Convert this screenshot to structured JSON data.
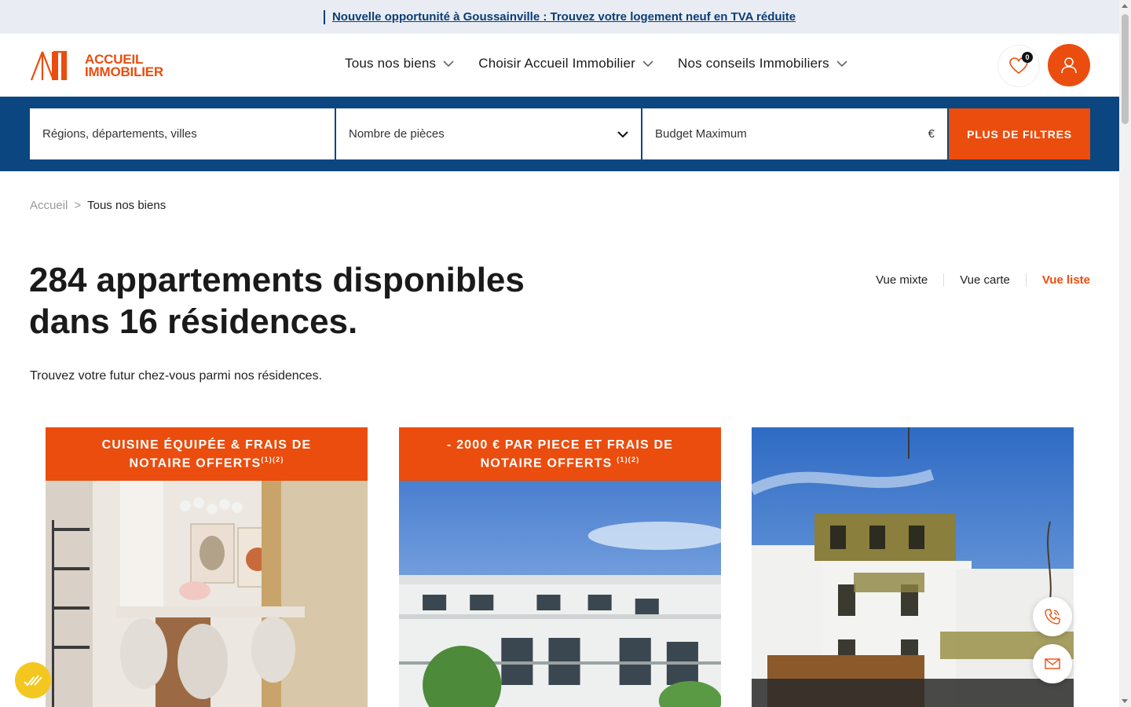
{
  "banner": {
    "text": "Nouvelle opportunité à Goussainville : Trouvez votre logement neuf en TVA réduite"
  },
  "header": {
    "logo_line1": "ACCUEIL",
    "logo_line2": "IMMOBILIER",
    "nav": [
      {
        "label": "Tous nos biens"
      },
      {
        "label": "Choisir Accueil Immobilier"
      },
      {
        "label": "Nos conseils Immobiliers"
      }
    ],
    "favorites_count": "0",
    "accent_color": "#ea4d0e",
    "brand_blue": "#0b4680"
  },
  "search": {
    "location_placeholder": "Régions, départements, villes",
    "rooms_placeholder": "Nombre de pièces",
    "budget_placeholder": "Budget Maximum",
    "currency": "€",
    "filters_button": "PLUS DE FILTRES"
  },
  "breadcrumb": {
    "home": "Accueil",
    "separator": ">",
    "current": "Tous nos biens"
  },
  "main": {
    "title_line1": "284 appartements disponibles",
    "title_line2": "dans 16 résidences.",
    "subtitle": "Trouvez votre futur chez-vous parmi nos résidences.",
    "views": [
      {
        "label": "Vue mixte",
        "active": false
      },
      {
        "label": "Vue carte",
        "active": false
      },
      {
        "label": "Vue liste",
        "active": true
      }
    ]
  },
  "cards": [
    {
      "badge": "CUISINE ÉQUIPÉE & FRAIS DE NOTAIRE OFFERTS",
      "badge_sup": "(1)(2)"
    },
    {
      "badge": "- 2000 € PAR PIECE ET FRAIS DE NOTAIRE OFFERTS",
      "badge_sup": "(1)(2)"
    },
    {
      "badge": "",
      "badge_sup": ""
    }
  ],
  "icons": {
    "favorites": "heart-icon",
    "account": "user-icon",
    "phone": "phone-icon",
    "mail": "mail-icon",
    "cookie": "cookie-consent-icon"
  }
}
